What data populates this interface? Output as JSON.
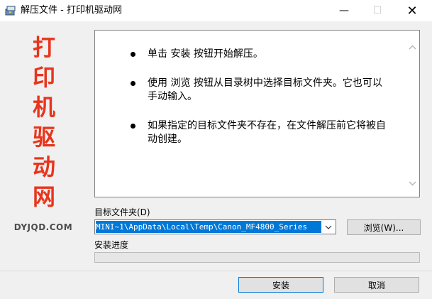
{
  "window": {
    "title": "解压文件 - 打印机驱动网",
    "min_glyph": "—",
    "max_glyph": "☐",
    "close_glyph": "✕",
    "icon": "archive-icon"
  },
  "brand": {
    "chars": [
      "打",
      "印",
      "机",
      "驱",
      "动",
      "网"
    ],
    "url": "DYJQD.COM",
    "color": "#e8351c"
  },
  "info": {
    "items": [
      "单击 安装 按钮开始解压。",
      "使用 浏览 按钮从目录树中选择目标文件夹。它也可以手动输入。",
      "如果指定的目标文件夹不存在，在文件解压前它将被自动创建。"
    ]
  },
  "target": {
    "label": "目标文件夹(D)",
    "path": "MINI~1\\AppData\\Local\\Temp\\Canon_MF4800_Series",
    "browse_label": "浏览(W)..."
  },
  "progress": {
    "label": "安装进度",
    "value": 0
  },
  "actions": {
    "install_label": "安装",
    "cancel_label": "取消"
  }
}
